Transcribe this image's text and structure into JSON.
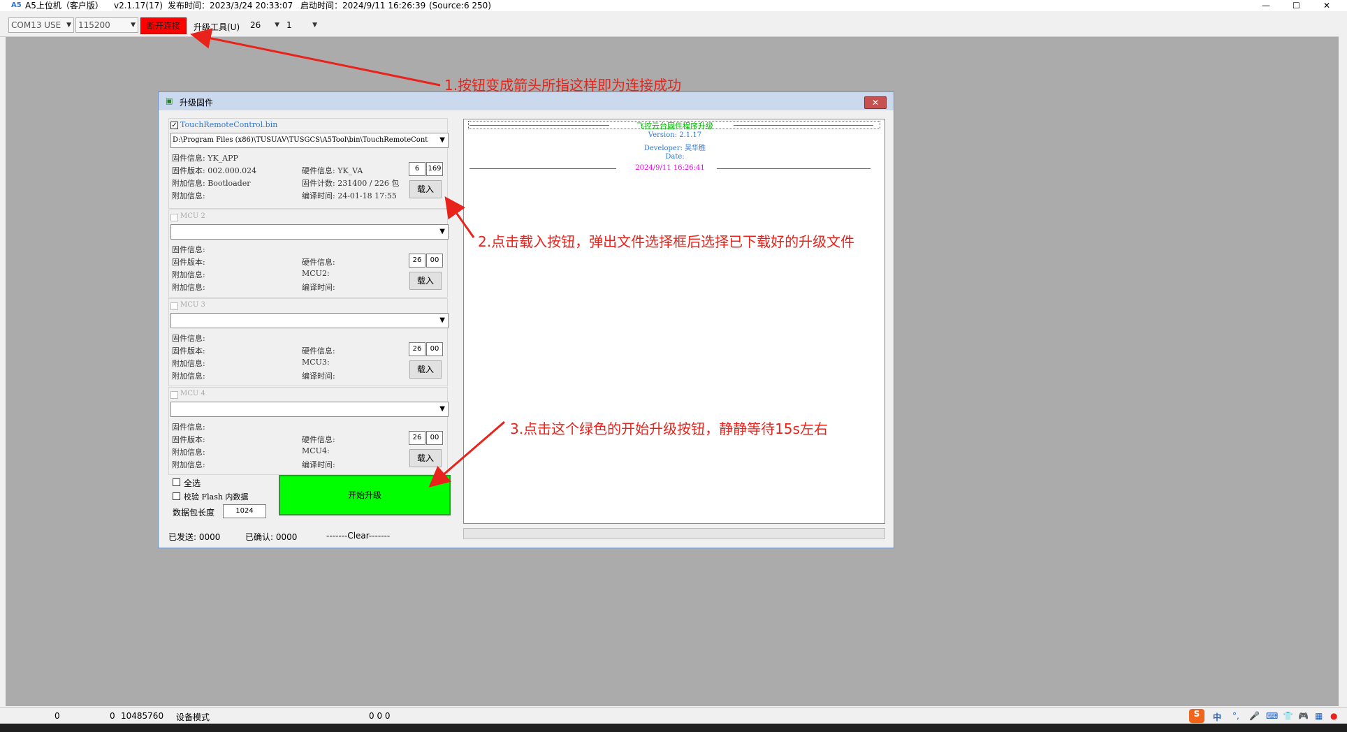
{
  "window": {
    "app_name": "A5上位机（客户版）",
    "version": "v2.1.17(17)",
    "release_time": "发布时间：2023/3/24 20:33:07",
    "start_time": "启动时间：2024/9/11 16:26:39",
    "source": "(Source:6 250)"
  },
  "toolbar": {
    "port": "COM13 USE",
    "baud": "115200",
    "disconnect_label": "断开连接",
    "upgrade_tool_label": "升级工具(U)",
    "combo_a": "26",
    "combo_b": "1"
  },
  "dialog": {
    "title": "升级固件",
    "close_label": "✕",
    "mcu1": {
      "file_name": "TouchRemoteControl.bin",
      "path": "D:\\Program Files (x86)\\TUSUAV\\TUSGCS\\A5Tool\\bin\\TouchRemoteCont",
      "fw_info": "固件信息: YK_APP",
      "fw_version": "固件版本: 002.000.024",
      "extra1": "附加信息: Bootloader",
      "extra2": "附加信息:",
      "hw_info": "硬件信息: YK_VA",
      "fw_count": "固件计数: 231400 / 226 包",
      "compile_time": "编译时间: 24-01-18 17:55",
      "num1": "6",
      "num2": "169",
      "load_label": "载入"
    },
    "mcu2": {
      "label": "MCU 2",
      "fw_info": "固件信息:",
      "fw_version": "固件版本:",
      "extra1": "附加信息:",
      "extra2": "附加信息:",
      "hw_info": "硬件信息:",
      "mcu": "MCU2:",
      "compile_time": "编译时间:",
      "num1": "26",
      "num2": "00",
      "load_label": "载入"
    },
    "mcu3": {
      "label": "MCU 3",
      "fw_info": "固件信息:",
      "fw_version": "固件版本:",
      "extra1": "附加信息:",
      "extra2": "附加信息:",
      "hw_info": "硬件信息:",
      "mcu": "MCU3:",
      "compile_time": "编译时间:",
      "num1": "26",
      "num2": "00",
      "load_label": "载入"
    },
    "mcu4": {
      "label": "MCU 4",
      "fw_info": "固件信息:",
      "fw_version": "固件版本:",
      "extra1": "附加信息:",
      "extra2": "附加信息:",
      "hw_info": "硬件信息:",
      "mcu": "MCU4:",
      "compile_time": "编译时间:",
      "num1": "26",
      "num2": "00",
      "load_label": "载入"
    },
    "select_all": "全选",
    "verify_flash": "校验 Flash 内数据",
    "packet_len_label": "数据包长度",
    "packet_len": "1024",
    "start_label": "开始升级",
    "log": {
      "title": "飞控云台固件程序升级",
      "version": "Version: 2.1.17",
      "developer": "Developer: 吴华胜",
      "date": "Date:",
      "timestamp": "2024/9/11 16:26:41"
    },
    "status": {
      "sent": "已发送: 0000",
      "confirmed": "已确认: 0000",
      "clear": "-------Clear-------"
    }
  },
  "annotations": {
    "step1": "1.按钮变成箭头所指这样即为连接成功",
    "step2": "2.点击载入按钮，弹出文件选择框后选择已下载好的升级文件",
    "step3": "3.点击这个绿色的开始升级按钮，静静等待15s左右"
  },
  "statusbar": {
    "v1": "0",
    "v2": "0",
    "v3": "10485760",
    "mode": "设备模式",
    "v4": "0 0 0"
  },
  "tray": {
    "ime": "中",
    "punct": "°,"
  },
  "colors": {
    "disconnect_bg": "#ff0000",
    "start_bg": "#00ff00",
    "annotation": "#e8231c",
    "log_title": "#00b400",
    "log_text": "#2b78d8",
    "log_time": "#e600e6"
  }
}
